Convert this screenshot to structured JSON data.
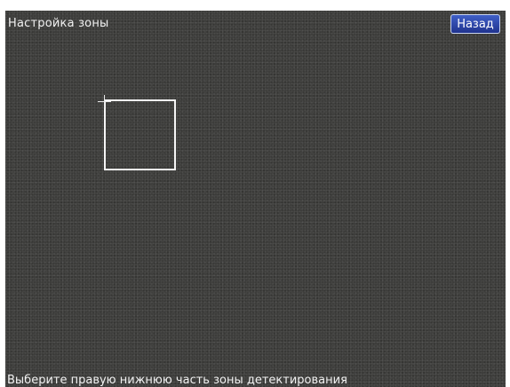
{
  "screen": {
    "title": "Настройка зоны",
    "back_label": "Назад",
    "instruction": "Выберите правую нижнюю часть зоны детектирования"
  },
  "colors": {
    "background": "#3d3d3b",
    "text": "#f2f2f2",
    "button": "#2f4aa8",
    "zone_border": "#f5f5f5"
  },
  "icons": {
    "cursor": "crosshair-icon"
  }
}
